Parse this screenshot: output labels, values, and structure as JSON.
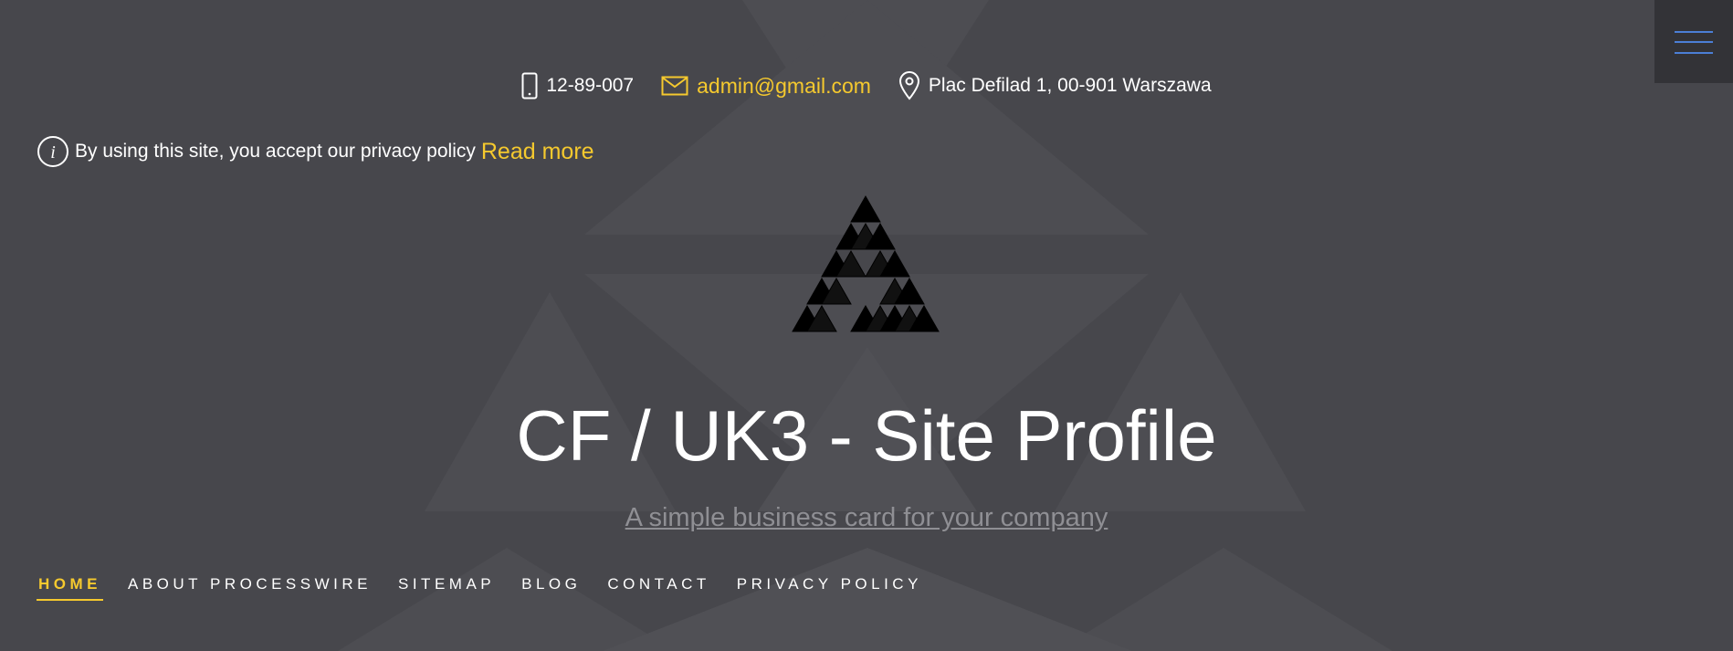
{
  "contact": {
    "phone": "12-89-007",
    "email": "admin@gmail.com",
    "address": "Plac Defilad 1, 00-901 Warszawa",
    "icons": [
      "phone-icon",
      "mail-icon",
      "location-pin-icon"
    ]
  },
  "privacy_notice": {
    "text": "By using this site, you accept our privacy policy",
    "link": "Read more",
    "icon": "info-icon"
  },
  "hero": {
    "title": "CF / UK3 - Site Profile",
    "tagline": "A simple business card for your company"
  },
  "nav": {
    "items": [
      "HOME",
      "ABOUT PROCESSWIRE",
      "SITEMAP",
      "BLOG",
      "CONTACT",
      "PRIVACY POLICY"
    ],
    "active": "HOME"
  },
  "menu_button": {
    "icon": "hamburger-menu-icon"
  },
  "colors": {
    "background": "#47474c",
    "accent": "#f5c92e",
    "menu_accent": "#4c7fd6",
    "menu_bg": "#333337",
    "tagline": "#8f8f94"
  }
}
